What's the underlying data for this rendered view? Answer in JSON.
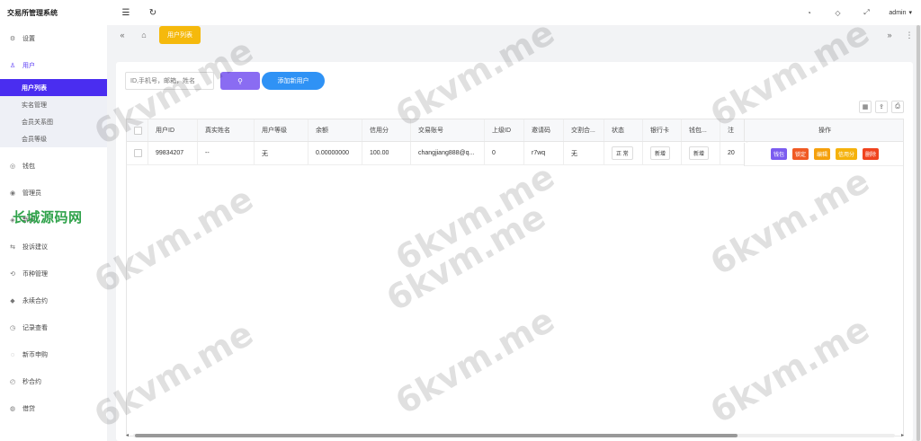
{
  "app": {
    "title": "交易所管理系统"
  },
  "topbar": {
    "left_icons": [
      "menu-fold-icon",
      "refresh-icon"
    ],
    "right_icons": [
      "theme-icon",
      "tag-icon",
      "fullscreen-icon"
    ],
    "user": "admin"
  },
  "sidebar": {
    "items": [
      {
        "label": "设置",
        "icon": "gear-icon"
      },
      {
        "label": "用户",
        "icon": "user-icon",
        "open": true,
        "children": [
          "用户列表",
          "实名管理",
          "会员关系图",
          "会员等级"
        ]
      },
      {
        "label": "钱包",
        "icon": "wallet-icon"
      },
      {
        "label": "管理员",
        "icon": "admin-icon"
      },
      {
        "label": "新闻",
        "icon": "news-icon"
      },
      {
        "label": "投诉建议",
        "icon": "feedback-icon"
      },
      {
        "label": "币种管理",
        "icon": "coin-icon"
      },
      {
        "label": "永续合约",
        "icon": "contract-icon"
      },
      {
        "label": "记录查看",
        "icon": "record-icon"
      },
      {
        "label": "新币申购",
        "icon": "subscribe-icon"
      },
      {
        "label": "秒合约",
        "icon": "timer-icon"
      },
      {
        "label": "借贷",
        "icon": "loan-icon"
      }
    ],
    "active_child": "用户列表",
    "overlay_text": "长城源码网"
  },
  "tabs": {
    "active": "用户列表"
  },
  "toolbar": {
    "search_placeholder": "ID,手机号，邮箱，姓名",
    "add_label": "添加新用户"
  },
  "table": {
    "columns": [
      "用户ID",
      "真实姓名",
      "用户等级",
      "余额",
      "信用分",
      "交易账号",
      "上级ID",
      "邀请码",
      "交割合...",
      "状态",
      "银行卡",
      "钱包...",
      "注"
    ],
    "ops_header": "操作",
    "rows": [
      {
        "id": "99834207",
        "name": "--",
        "level": "无",
        "balance": "0.00000000",
        "credit": "100.00",
        "account": "changjiang888@q...",
        "parent": "0",
        "invite": "r7wq",
        "delivery": "无",
        "status": "正 常",
        "bank": "新增",
        "wallet": "新增",
        "reg": "20",
        "ops": [
          {
            "label": "钱包",
            "color": "#7b5cf0"
          },
          {
            "label": "锁定",
            "color": "#f05a24"
          },
          {
            "label": "编辑",
            "color": "#f5a00c"
          },
          {
            "label": "信用分",
            "color": "#f5b20c"
          },
          {
            "label": "删除",
            "color": "#f0431e"
          }
        ]
      }
    ]
  },
  "watermark": "6kvm.me"
}
